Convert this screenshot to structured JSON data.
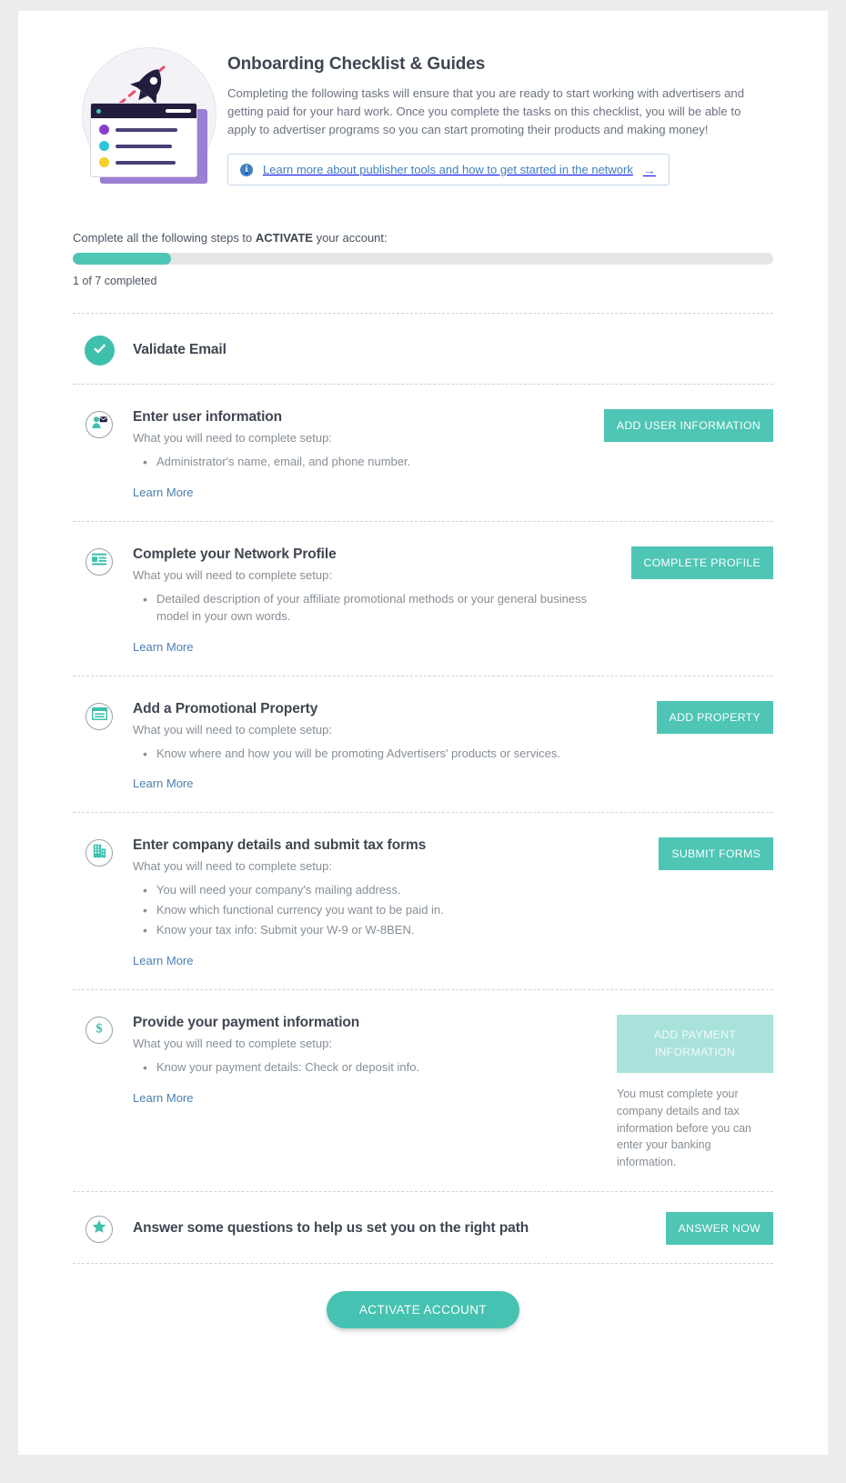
{
  "header": {
    "title": "Onboarding Checklist & Guides",
    "intro": "Completing the following tasks will ensure that you are ready to start working with advertisers and getting paid for your hard work. Once you complete the tasks on this checklist, you will be able to apply to advertiser programs so you can start promoting their products and making money!",
    "info_banner": {
      "icon": "info-icon",
      "text": "Learn more about publisher tools and how to get started in the network",
      "arrow": "→"
    }
  },
  "progress": {
    "label_prefix": "Complete all the following steps to ",
    "label_strong": "ACTIVATE",
    "label_suffix": " your account:",
    "completed": 1,
    "total": 7,
    "percent": 14,
    "count_text": "1 of 7 completed",
    "fill_color": "#4ec5b5",
    "track_color": "#e4e6e8"
  },
  "items": [
    {
      "icon": "check-icon",
      "state": "completed",
      "title": "Validate Email"
    },
    {
      "icon": "user-envelope-icon",
      "state": "pending",
      "title": "Enter user information",
      "subtitle": "What you will need to complete setup:",
      "requirements": [
        "Administrator's name, email, and phone number."
      ],
      "learn_more": "Learn More",
      "button": {
        "label": "ADD USER INFORMATION",
        "disabled": false
      }
    },
    {
      "icon": "profile-lines-icon",
      "state": "pending",
      "title": "Complete your Network Profile",
      "subtitle": "What you will need to complete setup:",
      "requirements": [
        "Detailed description of your affiliate promotional methods or your general business model in your own words."
      ],
      "learn_more": "Learn More",
      "button": {
        "label": "COMPLETE PROFILE",
        "disabled": false
      }
    },
    {
      "icon": "browser-window-icon",
      "state": "pending",
      "title": "Add a Promotional Property",
      "subtitle": "What you will need to complete setup:",
      "requirements": [
        "Know where and how you will be promoting Advertisers' products or services."
      ],
      "learn_more": "Learn More",
      "button": {
        "label": "ADD PROPERTY",
        "disabled": false
      }
    },
    {
      "icon": "building-icon",
      "state": "pending",
      "title": "Enter company details and submit tax forms",
      "subtitle": "What you will need to complete setup:",
      "requirements": [
        "You will need your company's mailing address.",
        "Know which functional currency you want to be paid in.",
        "Know your tax info: Submit your W-9 or W-8BEN."
      ],
      "learn_more": "Learn More",
      "button": {
        "label": "SUBMIT FORMS",
        "disabled": false
      }
    },
    {
      "icon": "dollar-icon",
      "state": "pending",
      "title": "Provide your payment information",
      "subtitle": "What you will need to complete setup:",
      "requirements": [
        "Know your payment details: Check or deposit info."
      ],
      "learn_more": "Learn More",
      "button": {
        "label": "ADD PAYMENT INFORMATION",
        "disabled": true
      },
      "note": "You must complete your company details and tax information before you can enter your banking information."
    },
    {
      "icon": "star-icon",
      "state": "pending",
      "title": "Answer some questions to help us set you on the right path",
      "button": {
        "label": "ANSWER NOW",
        "disabled": false
      }
    }
  ],
  "footer": {
    "activate_label": "ACTIVATE ACCOUNT"
  }
}
